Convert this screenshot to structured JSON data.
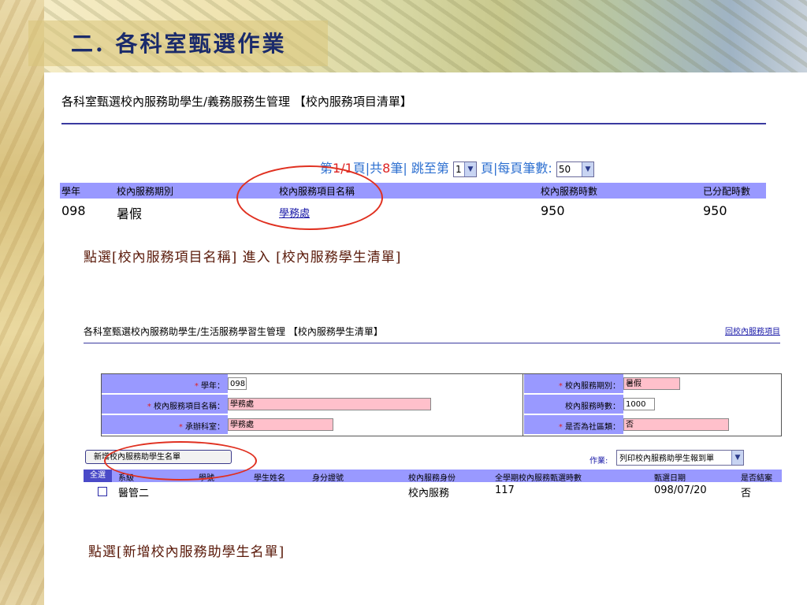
{
  "slide": {
    "title": "二. 各科室甄選作業",
    "caption1": "點選[校內服務項目名稱] 進入 [校內服務學生清單]",
    "caption2": "點選[新增校內服務助學生名單]"
  },
  "screen1": {
    "header": "各科室甄選校內服務助學生/義務服務生管理 【校內服務項目清單】",
    "pager": {
      "prefix": "第",
      "page": "1/1",
      "mid": "頁|共",
      "count": "8",
      "suffix": "筆| 跳至第",
      "jump_value": "1",
      "per_page_label": "頁|每頁筆數:",
      "per_page_value": "50"
    },
    "columns": [
      "學年",
      "校內服務期別",
      "校內服務項目名稱",
      "校內服務時數",
      "已分配時數"
    ],
    "rows": [
      {
        "year": "098",
        "period": "暑假",
        "item": "學務處",
        "hours": "950",
        "allocated": "950"
      }
    ]
  },
  "screen2": {
    "header": "各科室甄選校內服務助學生/生活服務學習生管理 【校內服務學生清單】",
    "back_link": "回校內服務項目",
    "form": {
      "year_label": "學年：",
      "year_value": "098",
      "period_label": "校內服務期別：",
      "period_value": "暑假",
      "item_label": "校內服務項目名稱：",
      "item_value": "學務處",
      "hours_label": "校內服務時數：",
      "hours_value": "1000",
      "dept_label": "承辦科室：",
      "dept_value": "學務處",
      "community_label": "是否為社區類：",
      "community_value": "否",
      "required_mark": "*"
    },
    "add_button": "新增校內服務助學生名單",
    "operation_label": "作業:",
    "operation_value": "列印校內服務助學生報到單",
    "select_all": "全選",
    "columns": [
      "系級",
      "學號",
      "學生姓名",
      "身分證號",
      "校內服務身份",
      "全學期校內服務甄選時數",
      "甄選日期",
      "是否結案"
    ],
    "rows": [
      {
        "class": "醫管二",
        "student_id": "",
        "name": "",
        "id_no": "",
        "identity": "校內服務",
        "hours": "117",
        "date": "098/07/20",
        "closed": "否"
      }
    ]
  }
}
